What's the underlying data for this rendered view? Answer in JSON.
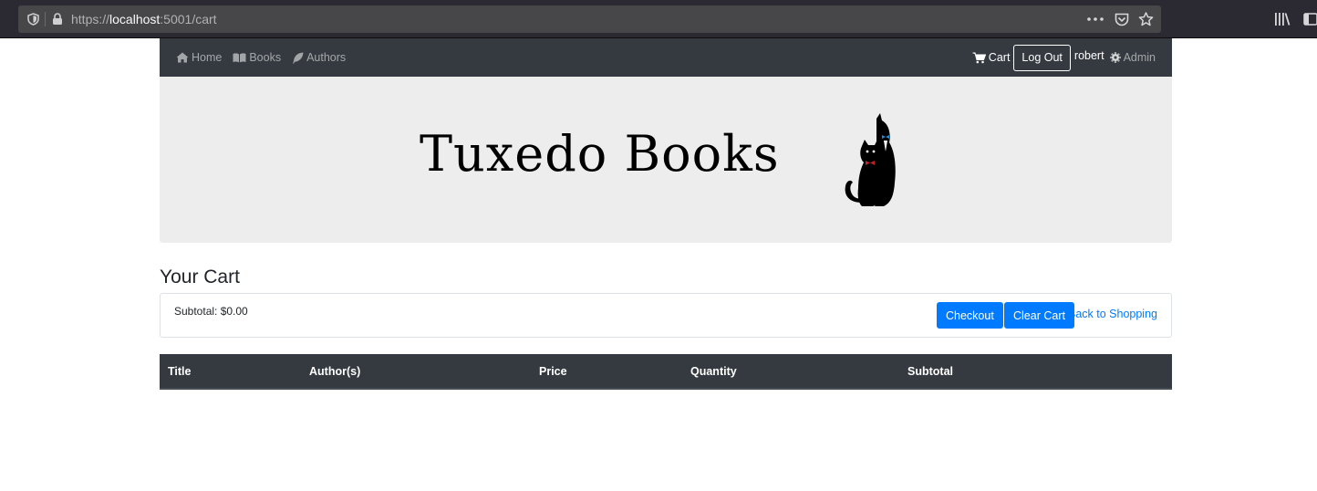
{
  "browser": {
    "url_scheme": "https://",
    "url_host": "localhost",
    "url_path": ":5001/cart",
    "more_icon": "ellipsis-icon",
    "pocket_icon": "pocket-icon",
    "bookmark_icon": "star-icon",
    "library_icon": "library-icon",
    "sidebar_icon": "sidebar-icon"
  },
  "nav": {
    "home": "Home",
    "books": "Books",
    "authors": "Authors",
    "cart": "Cart",
    "logout": "Log Out",
    "username": "robert",
    "admin": "Admin"
  },
  "banner": {
    "logo_text": "Tuxedo Books"
  },
  "cart": {
    "title": "Your Cart",
    "subtotal": "Subtotal: $0.00",
    "checkout": "Checkout",
    "clear": "Clear Cart",
    "back": "Back to Shopping"
  },
  "table": {
    "columns": [
      "Title",
      "Author(s)",
      "Price",
      "Quantity",
      "Subtotal"
    ],
    "rows": []
  },
  "colors": {
    "navbar": "#343a40",
    "primary": "#007bff",
    "banner": "#ededed"
  }
}
